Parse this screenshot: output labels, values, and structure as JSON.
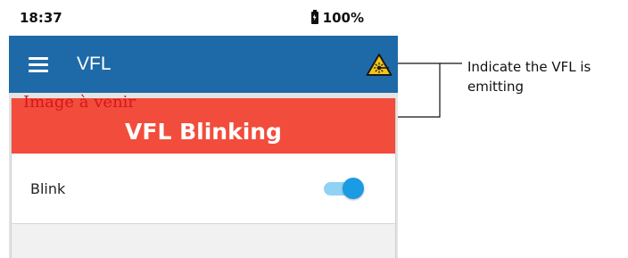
{
  "status_bar": {
    "time": "18:37",
    "battery": "100%",
    "battery_icon": "battery-charging-icon"
  },
  "app_bar": {
    "title": "VFL",
    "menu_icon": "hamburger-menu-icon",
    "status_icon": "laser-warning-icon",
    "color": "#1e6aa8"
  },
  "banner": {
    "text": "VFL Blinking",
    "color": "#f24c3c"
  },
  "blink_row": {
    "label": "Blink",
    "toggle_on": true,
    "toggle_color": "#1a9be3"
  },
  "watermark": "Image à venir",
  "callout": "Indicate the VFL is emitting"
}
